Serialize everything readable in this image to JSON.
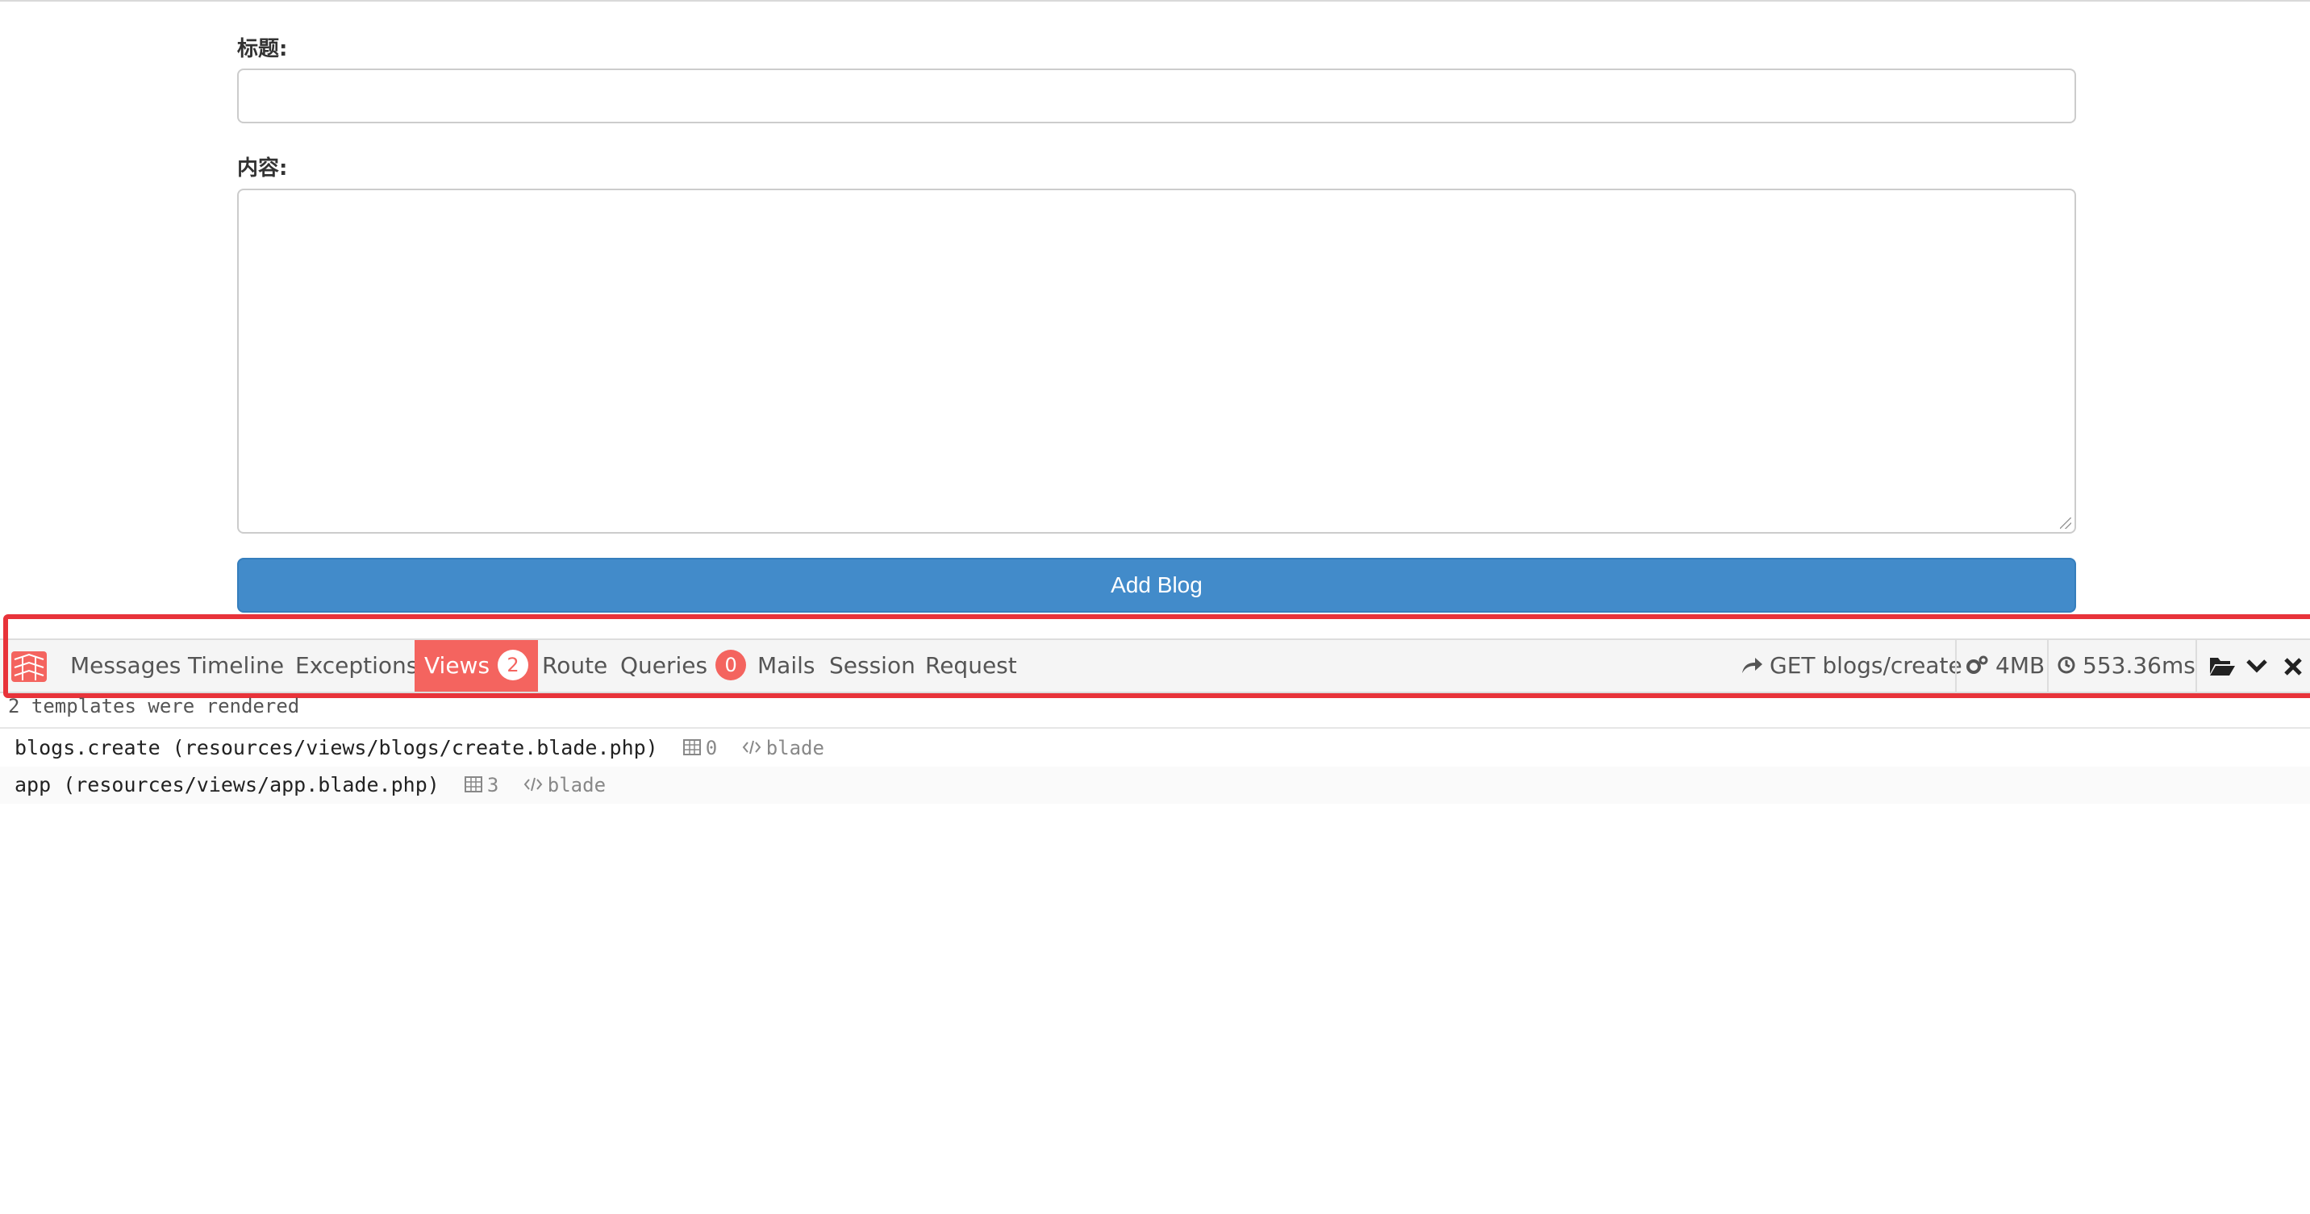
{
  "form": {
    "title_label": "标题:",
    "title_value": "",
    "content_label": "内容:",
    "content_value": "",
    "submit_label": "Add Blog"
  },
  "debugbar": {
    "tabs": [
      {
        "label": "Messages"
      },
      {
        "label": "Timeline"
      },
      {
        "label": "Exceptions"
      },
      {
        "label": "Views",
        "badge": "2"
      },
      {
        "label": "Route"
      },
      {
        "label": "Queries",
        "badge": "0"
      },
      {
        "label": "Mails"
      },
      {
        "label": "Session"
      },
      {
        "label": "Request"
      }
    ],
    "active_tab": "Views",
    "request": "GET blogs/create",
    "memory": "4MB",
    "time": "553.36ms",
    "icons": [
      "laravel-logo-icon",
      "share-arrow-icon",
      "cogs-icon",
      "clock-icon",
      "folder-open-icon",
      "chevron-down-icon",
      "close-icon"
    ],
    "accent_color": "#f4645f"
  },
  "views_panel": {
    "header": "2 templates were rendered",
    "rows": [
      {
        "name": "blogs.create (resources/views/blogs/create.blade.php)",
        "params": "0",
        "type": "blade"
      },
      {
        "name": "app (resources/views/app.blade.php)",
        "params": "3",
        "type": "blade"
      }
    ]
  },
  "colors": {
    "primary_button": "#428bca",
    "highlight_border": "#e8333a"
  }
}
